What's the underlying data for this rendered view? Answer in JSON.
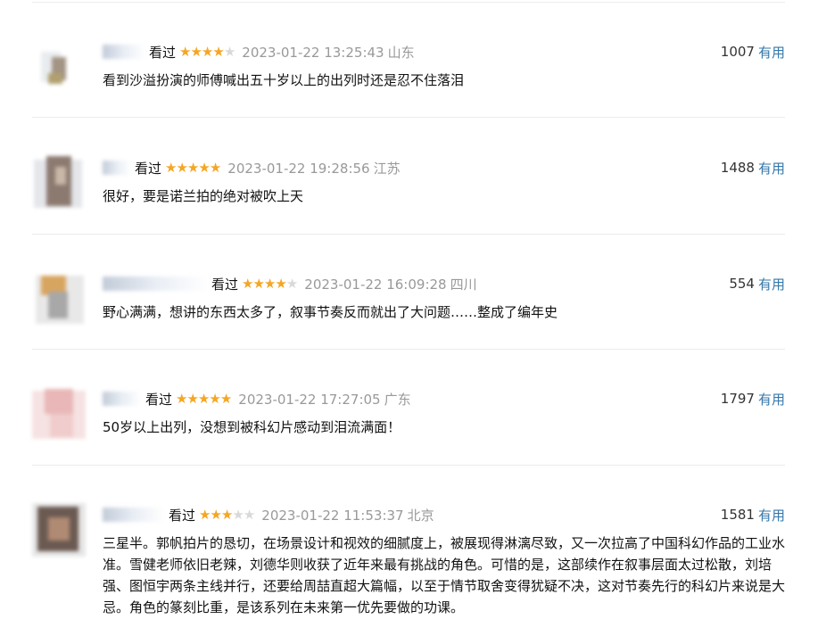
{
  "common": {
    "watched_label": "看过",
    "useful_label": "有用"
  },
  "comments": [
    {
      "stars": 4,
      "time": "2023-01-22 13:25:43",
      "location": "山东",
      "votes": "1007",
      "content": "看到沙溢扮演的师傅喊出五十岁以上的出列时还是忍不住落泪"
    },
    {
      "stars": 5,
      "time": "2023-01-22 19:28:56",
      "location": "江苏",
      "votes": "1488",
      "content": "很好，要是诺兰拍的绝对被吹上天"
    },
    {
      "stars": 4,
      "time": "2023-01-22 16:09:28",
      "location": "四川",
      "votes": "554",
      "content": "野心满满，想讲的东西太多了，叙事节奏反而就出了大问题……整成了编年史"
    },
    {
      "stars": 5,
      "time": "2023-01-22 17:27:05",
      "location": "广东",
      "votes": "1797",
      "content": "50岁以上出列，没想到被科幻片感动到泪流满面！"
    },
    {
      "stars": 3,
      "time": "2023-01-22 11:53:37",
      "location": "北京",
      "votes": "1581",
      "content": "三星半。郭帆拍片的恳切，在场景设计和视效的细腻度上，被展现得淋漓尽致，又一次拉高了中国科幻作品的工业水准。雪健老师依旧老辣，刘德华则收获了近年来最有挑战的角色。可惜的是，这部续作在叙事层面太过松散，刘培强、图恒宇两条主线并行，还要给周喆直超大篇幅，以至于情节取舍变得犹疑不决，这对节奏先行的科幻片来说是大忌。角色的篆刻比重，是该系列在未来第一优先要做的功课。"
    }
  ]
}
